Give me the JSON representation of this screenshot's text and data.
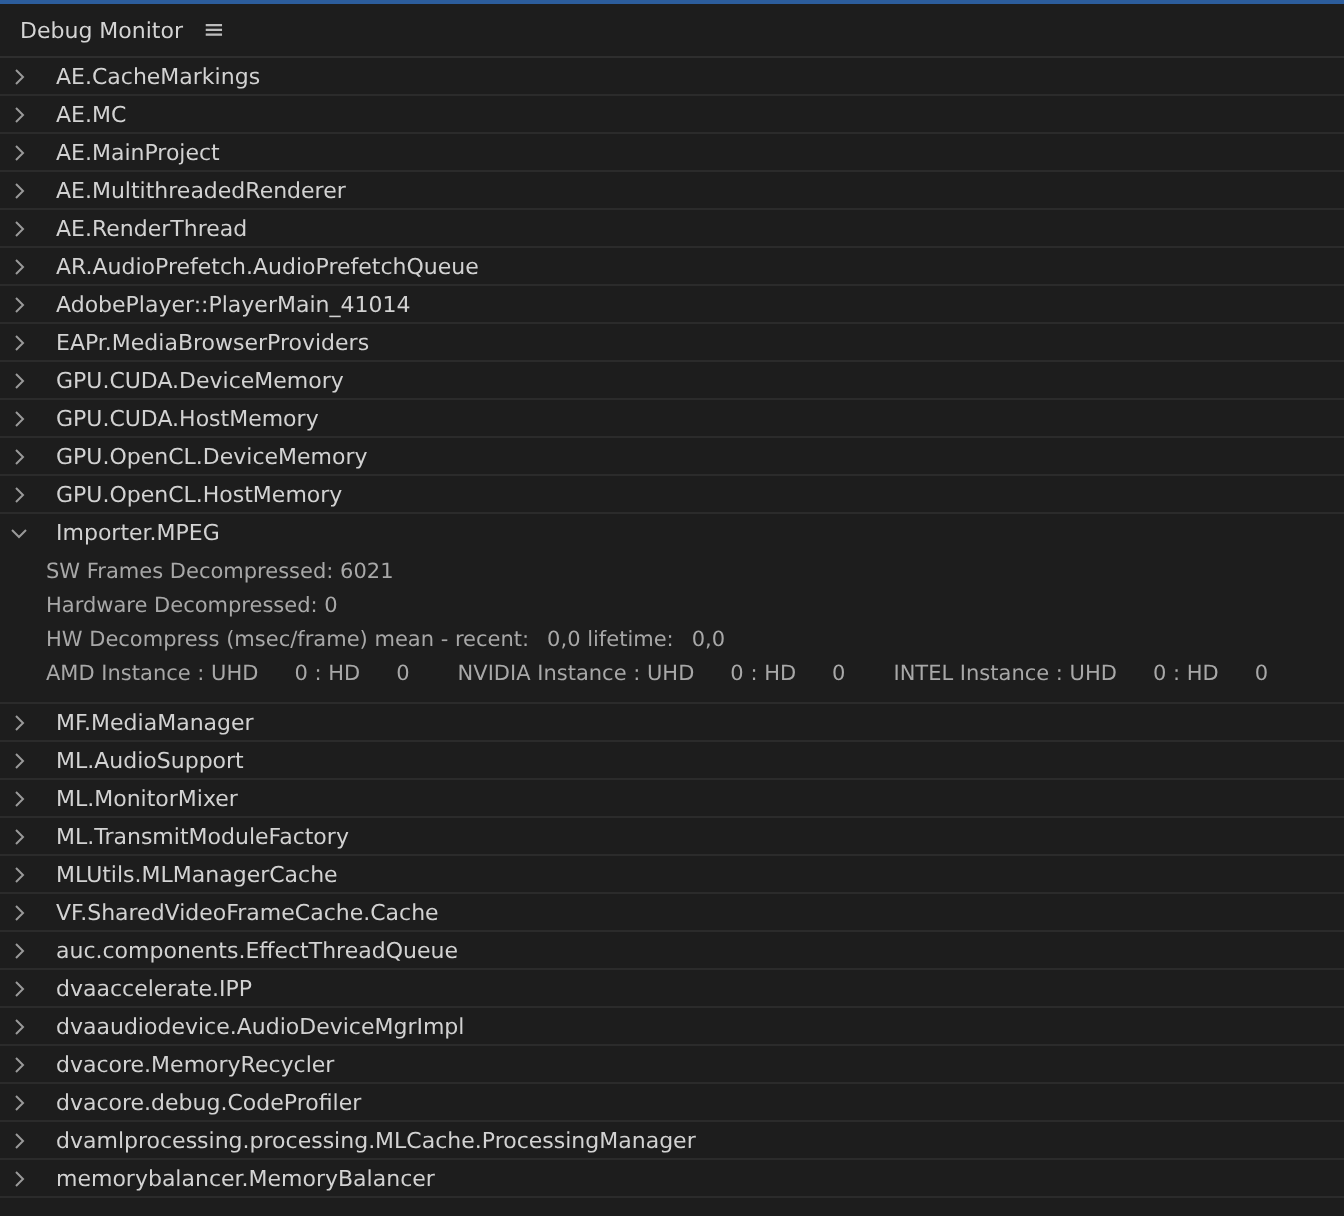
{
  "panel": {
    "title": "Debug Monitor",
    "menu_icon": "≡"
  },
  "items": [
    {
      "label": "AE.CacheMarkings",
      "expanded": false
    },
    {
      "label": "AE.MC",
      "expanded": false
    },
    {
      "label": "AE.MainProject",
      "expanded": false
    },
    {
      "label": "AE.MultithreadedRenderer",
      "expanded": false
    },
    {
      "label": "AE.RenderThread",
      "expanded": false
    },
    {
      "label": "AR.AudioPrefetch.AudioPrefetchQueue",
      "expanded": false
    },
    {
      "label": "AdobePlayer::PlayerMain_41014",
      "expanded": false
    },
    {
      "label": "EAPr.MediaBrowserProviders",
      "expanded": false
    },
    {
      "label": "GPU.CUDA.DeviceMemory",
      "expanded": false
    },
    {
      "label": "GPU.CUDA.HostMemory",
      "expanded": false
    },
    {
      "label": "GPU.OpenCL.DeviceMemory",
      "expanded": false
    },
    {
      "label": "GPU.OpenCL.HostMemory",
      "expanded": false
    },
    {
      "label": "Importer.MPEG",
      "expanded": true,
      "details": [
        {
          "parts": [
            "SW Frames Decompressed: 6021"
          ]
        },
        {
          "parts": [
            "Hardware Decompressed: 0"
          ]
        },
        {
          "parts": [
            "HW Decompress (msec/frame) mean - recent:",
            "0,0 lifetime:",
            "0,0"
          ]
        },
        {
          "parts": [
            "AMD Instance : UHD",
            "0 : HD",
            "0",
            "NVIDIA Instance : UHD",
            "0 : HD",
            "0",
            "INTEL Instance : UHD",
            "0 : HD",
            "0"
          ]
        }
      ]
    },
    {
      "label": "MF.MediaManager",
      "expanded": false
    },
    {
      "label": "ML.AudioSupport",
      "expanded": false
    },
    {
      "label": "ML.MonitorMixer",
      "expanded": false
    },
    {
      "label": "ML.TransmitModuleFactory",
      "expanded": false
    },
    {
      "label": "MLUtils.MLManagerCache",
      "expanded": false
    },
    {
      "label": "VF.SharedVideoFrameCache.Cache",
      "expanded": false
    },
    {
      "label": "auc.components.EffectThreadQueue",
      "expanded": false
    },
    {
      "label": "dvaaccelerate.IPP",
      "expanded": false
    },
    {
      "label": "dvaaudiodevice.AudioDeviceMgrImpl",
      "expanded": false
    },
    {
      "label": "dvacore.MemoryRecycler",
      "expanded": false
    },
    {
      "label": "dvacore.debug.CodeProfiler",
      "expanded": false
    },
    {
      "label": "dvamlprocessing.processing.MLCache.ProcessingManager",
      "expanded": false
    },
    {
      "label": "memorybalancer.MemoryBalancer",
      "expanded": false
    }
  ]
}
